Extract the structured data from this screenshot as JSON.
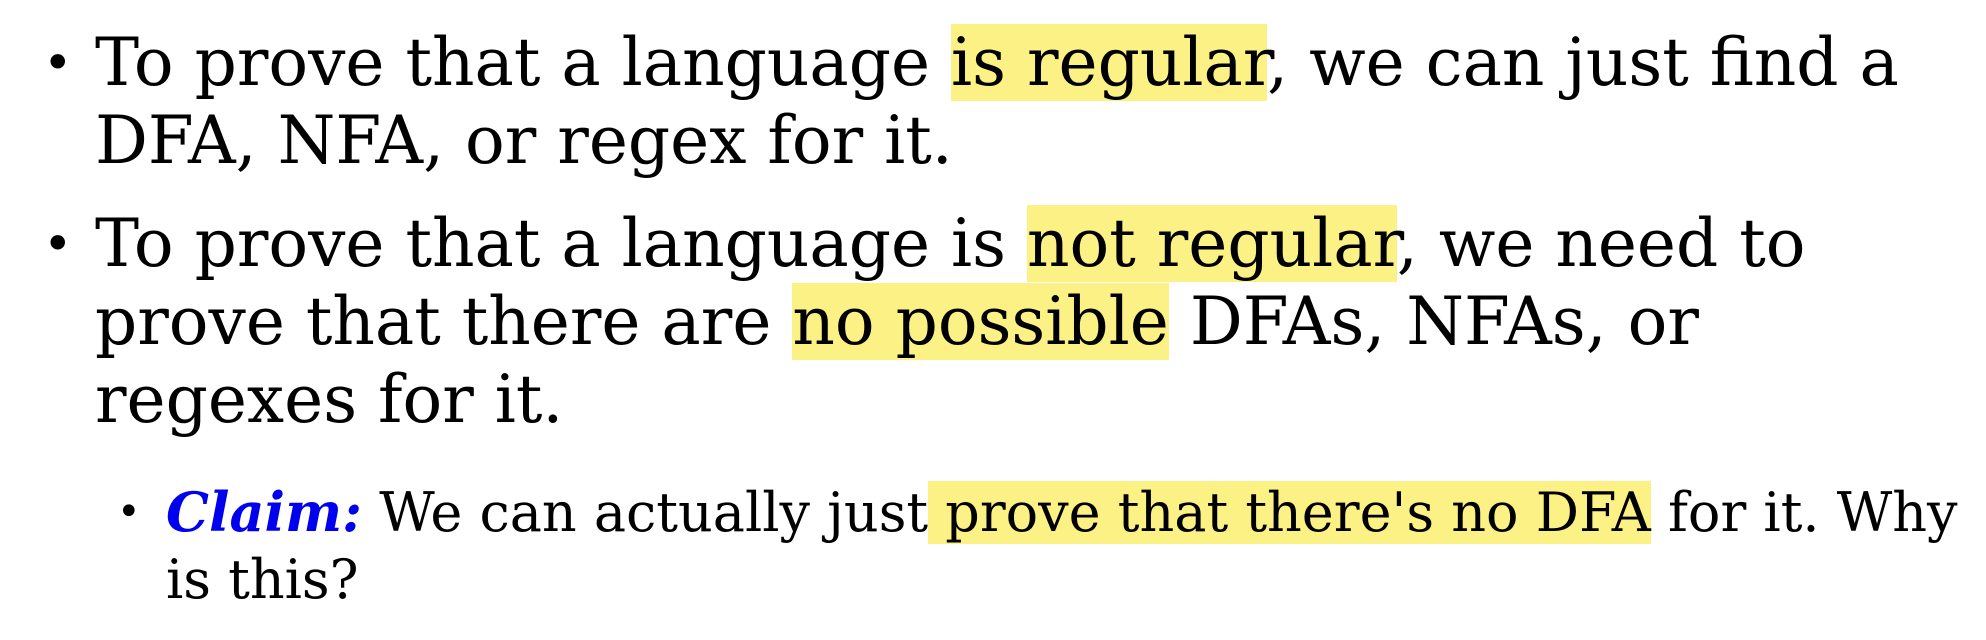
{
  "bullets": [
    {
      "pre": "To prove that a language ",
      "highlight": "is regular",
      "post": ", we can just find a DFA, NFA, or regex for it."
    },
    {
      "pre": "To prove that a language is ",
      "highlight": "not regular",
      "mid": ", we need to prove that there are ",
      "highlight2": "no possible",
      "post": " DFAs, NFAs, or regexes for it."
    }
  ],
  "sub_bullet": {
    "claim_label": "Claim:",
    "pre": " We can actually just",
    "highlight": " prove that there's no DFA",
    "post": " for it. Why is this?"
  },
  "colors": {
    "highlight": "#fbf184",
    "claim": "#0000ee"
  }
}
